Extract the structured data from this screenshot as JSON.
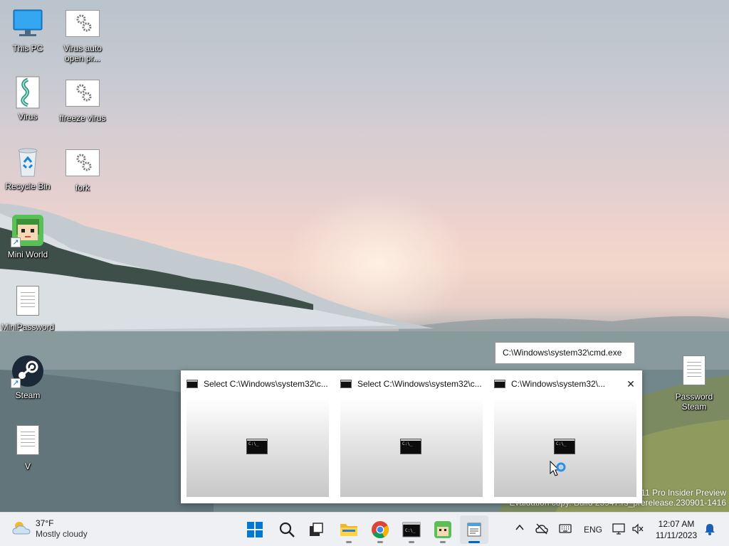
{
  "desktop": {
    "icons": [
      {
        "label": "This PC",
        "icon": "monitor-icon"
      },
      {
        "label": "Virus auto open pr...",
        "icon": "settings-file-icon"
      },
      {
        "label": "Virus",
        "icon": "script-file-icon"
      },
      {
        "label": "ffreeze virus",
        "icon": "settings-file-icon"
      },
      {
        "label": "Recycle Bin",
        "icon": "recycle-bin-icon"
      },
      {
        "label": "fork",
        "icon": "settings-file-icon"
      },
      {
        "label": "Mini World",
        "icon": "mini-world-icon"
      },
      {
        "label": "MiniPassword",
        "icon": "text-file-icon"
      },
      {
        "label": "Steam",
        "icon": "steam-icon"
      },
      {
        "label": "V",
        "icon": "text-file-icon"
      },
      {
        "label": "Password Steam",
        "icon": "text-file-icon"
      }
    ]
  },
  "tooltip": "C:\\Windows\\system32\\cmd.exe",
  "preview": {
    "items": [
      {
        "title": "Select C:\\Windows\\system32\\c...",
        "thumb_text": "C:\\_"
      },
      {
        "title": "Select C:\\Windows\\system32\\c...",
        "thumb_text": "C:\\_"
      },
      {
        "title": "C:\\Windows\\system32\\...",
        "thumb_text": "C:\\_"
      }
    ],
    "close_glyph": "✕"
  },
  "watermark": {
    "line1": "11 Pro Insider Preview",
    "line2": "Evaluation copy. Build 25947.rs_prerelease.230901-1416"
  },
  "taskbar": {
    "weather": {
      "temp": "37°F",
      "condition": "Mostly cloudy"
    },
    "apps": [
      {
        "name": "start",
        "icon": "windows-logo-icon"
      },
      {
        "name": "search",
        "icon": "search-icon"
      },
      {
        "name": "task-view",
        "icon": "task-view-icon"
      },
      {
        "name": "file-explorer",
        "icon": "folder-icon"
      },
      {
        "name": "chrome",
        "icon": "chrome-icon"
      },
      {
        "name": "command-prompt",
        "icon": "cmd-icon"
      },
      {
        "name": "mini-world",
        "icon": "mini-world-icon"
      },
      {
        "name": "notepad",
        "icon": "notepad-icon"
      }
    ],
    "tray": {
      "chevron": "^",
      "language": "ENG",
      "time": "12:07 AM",
      "date": "11/11/2023"
    }
  }
}
